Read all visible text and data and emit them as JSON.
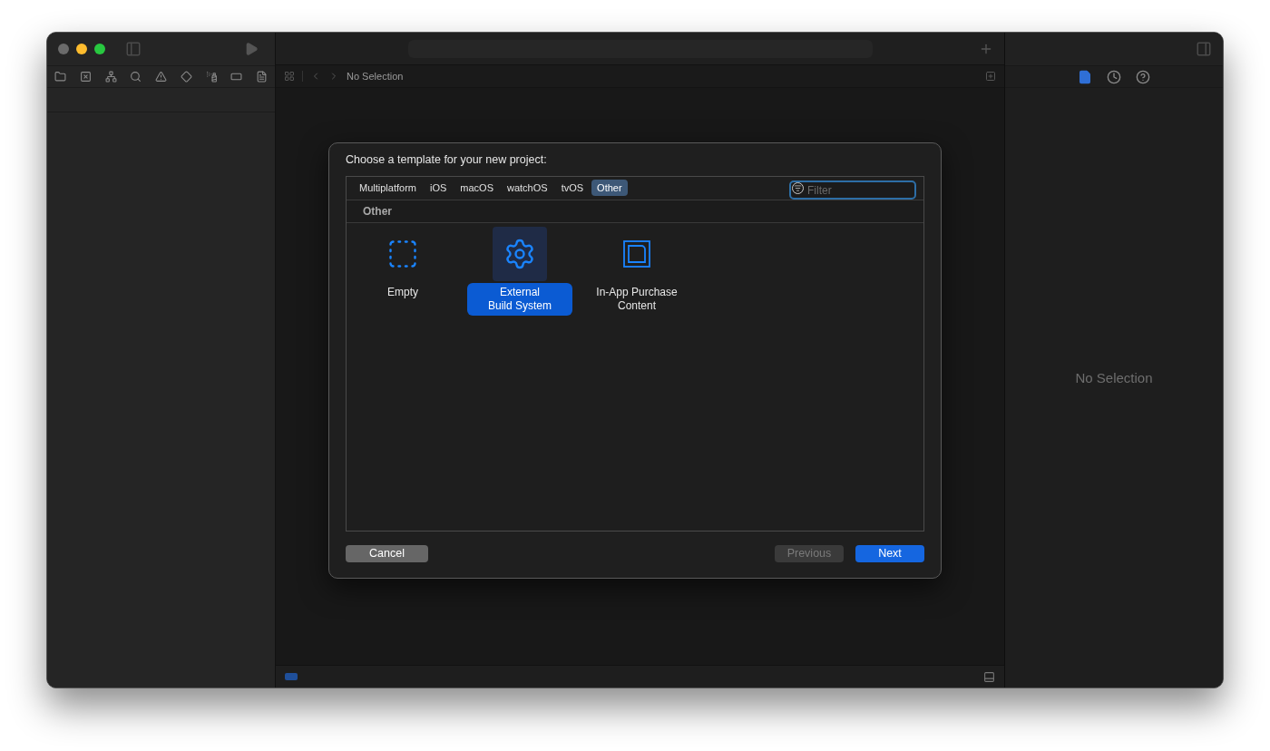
{
  "editor": {
    "path": "No Selection"
  },
  "inspector": {
    "tabs": [
      {
        "kind": "file",
        "selected": true
      },
      {
        "kind": "history",
        "selected": false
      },
      {
        "kind": "help",
        "selected": false
      }
    ],
    "message": "No Selection"
  },
  "dialog": {
    "title": "Choose a template for your new project:",
    "platform_tabs": [
      {
        "label": "Multiplatform",
        "selected": false
      },
      {
        "label": "iOS",
        "selected": false
      },
      {
        "label": "macOS",
        "selected": false
      },
      {
        "label": "watchOS",
        "selected": false
      },
      {
        "label": "tvOS",
        "selected": false
      },
      {
        "label": "Other",
        "selected": true
      }
    ],
    "filter": {
      "placeholder": "Filter"
    },
    "section_header": "Other",
    "templates": [
      {
        "kind": "empty",
        "label": "Empty",
        "selected": false
      },
      {
        "kind": "gear",
        "label": "External\nBuild System",
        "selected": true
      },
      {
        "kind": "purchase",
        "label": "In-App Purchase\nContent",
        "selected": false
      }
    ],
    "buttons": {
      "cancel": {
        "label": "Cancel"
      },
      "previous": {
        "label": "Previous",
        "disabled": true
      },
      "next": {
        "label": "Next",
        "disabled": false
      }
    }
  }
}
